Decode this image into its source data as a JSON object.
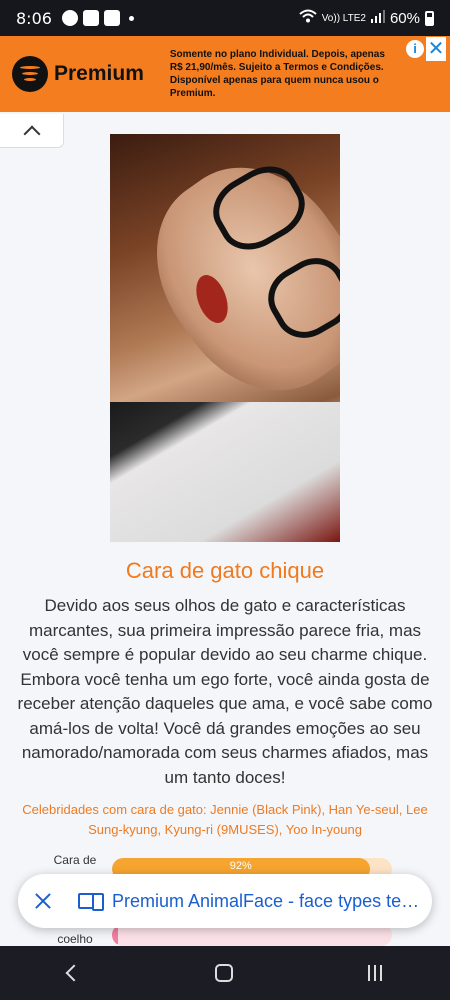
{
  "status_bar": {
    "time": "8:06",
    "network_label": "Vo)) LTE2",
    "battery": "60%"
  },
  "ad": {
    "brand": "Premium",
    "text": "Somente no plano Individual. Depois, apenas R$ 21,90/mês. Sujeito a Termos e Condições. Disponível apenas para quem nunca usou o Premium.",
    "info_glyph": "i",
    "close_glyph": "✕"
  },
  "result": {
    "title": "Cara de gato chique",
    "description": "Devido aos seus olhos de gato e características marcantes, sua primeira impressão parece fria, mas você sempre é popular devido ao seu charme chique. Embora você tenha um ego forte, você ainda gosta de receber atenção daqueles que ama, e você sabe como amá-los de volta! Você dá grandes emoções ao seu namorado/namorada com seus charmes afiados, mas um tanto doces!",
    "celebrities": "Celebridades com cara de gato: Jennie (Black Pink), Han Ye-seul, Lee Sung-kyung, Kyung-ri (9MUSES), Yoo In-young"
  },
  "bars": [
    {
      "label": "Cara de",
      "value_text": "92%",
      "value": 92,
      "color": "#f5a530"
    },
    {
      "label": "coelho",
      "value_text": "",
      "value": 2,
      "color": "#f27fa0"
    }
  ],
  "chip": {
    "text": "Premium AnimalFace - face types tes..."
  },
  "colors": {
    "accent": "#f07a1f",
    "ad_bg": "#f47d20",
    "link": "#1a5fd0"
  }
}
